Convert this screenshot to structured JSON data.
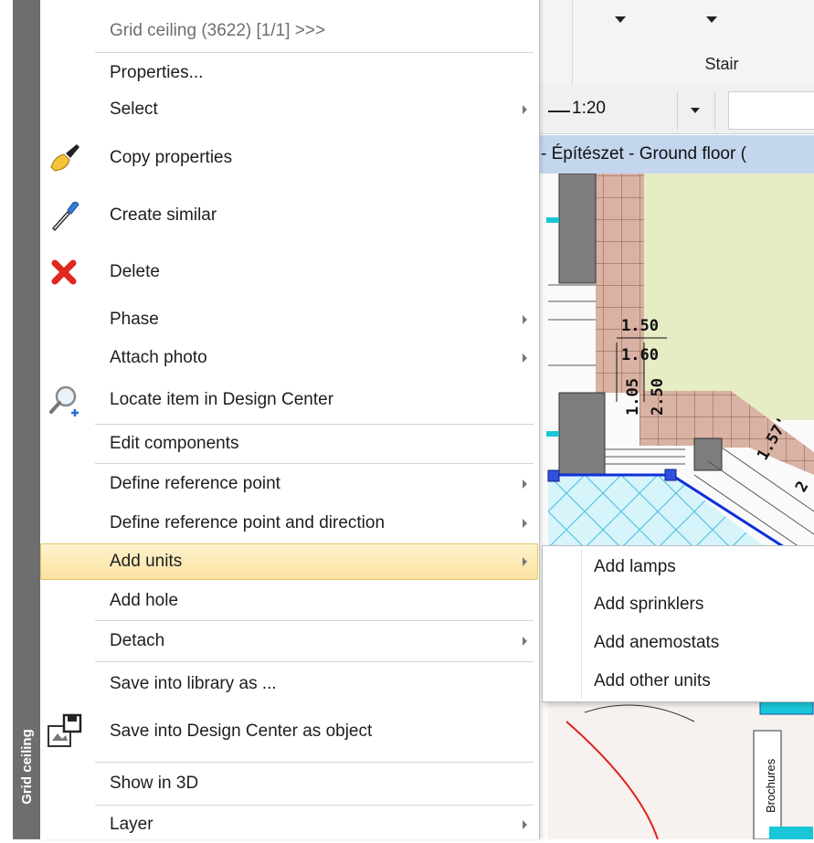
{
  "side_tab": {
    "label": "Grid ceiling"
  },
  "ribbon": {
    "group_label": "Stair"
  },
  "toolbar": {
    "scale": "1:20"
  },
  "document": {
    "title": "- Építészet - Ground floor ("
  },
  "drawing": {
    "dims": [
      "1.50",
      "1.60",
      "1.05",
      "2.50",
      "1.57'",
      "2"
    ],
    "brochures_label": "Brochures"
  },
  "context_menu": {
    "header": "Grid ceiling (3622) [1/1] >>>",
    "items": [
      {
        "label": "Properties...",
        "icon": "",
        "submenu": false
      },
      {
        "label": "Select",
        "icon": "",
        "submenu": true
      },
      {
        "label": "Copy properties",
        "icon": "paintbrush-icon",
        "submenu": false
      },
      {
        "label": "Create similar",
        "icon": "eyedropper-icon",
        "submenu": false
      },
      {
        "label": "Delete",
        "icon": "red-x-delete-icon",
        "submenu": false
      },
      {
        "label": "Phase",
        "icon": "",
        "submenu": true
      },
      {
        "label": "Attach photo",
        "icon": "",
        "submenu": true
      },
      {
        "label": "Locate item in Design Center",
        "icon": "magnifier-plus-icon",
        "submenu": false
      },
      {
        "label": "Edit components",
        "icon": "",
        "submenu": false
      },
      {
        "label": "Define reference point",
        "icon": "",
        "submenu": true
      },
      {
        "label": "Define reference point and direction",
        "icon": "",
        "submenu": true
      },
      {
        "label": "Add units",
        "icon": "",
        "submenu": true,
        "highlighted": true
      },
      {
        "label": "Add hole",
        "icon": "",
        "submenu": false
      },
      {
        "label": "Detach",
        "icon": "",
        "submenu": true
      },
      {
        "label": "Save into library as ...",
        "icon": "",
        "submenu": false
      },
      {
        "label": "Save into Design Center as object",
        "icon": "save-to-design-center-icon",
        "submenu": false
      },
      {
        "label": "Show in 3D",
        "icon": "",
        "submenu": false
      },
      {
        "label": "Layer",
        "icon": "",
        "submenu": true
      }
    ]
  },
  "add_units_submenu": {
    "items": [
      "Add lamps",
      "Add sprinklers",
      "Add anemostats",
      "Add other units"
    ]
  },
  "colors": {
    "highlight_fill": "#fbe3a0",
    "highlight_border": "#e5c365",
    "side_tab": "#6e6e6e",
    "title_bar": "#c3d6ee",
    "delete_red": "#e0281e"
  }
}
